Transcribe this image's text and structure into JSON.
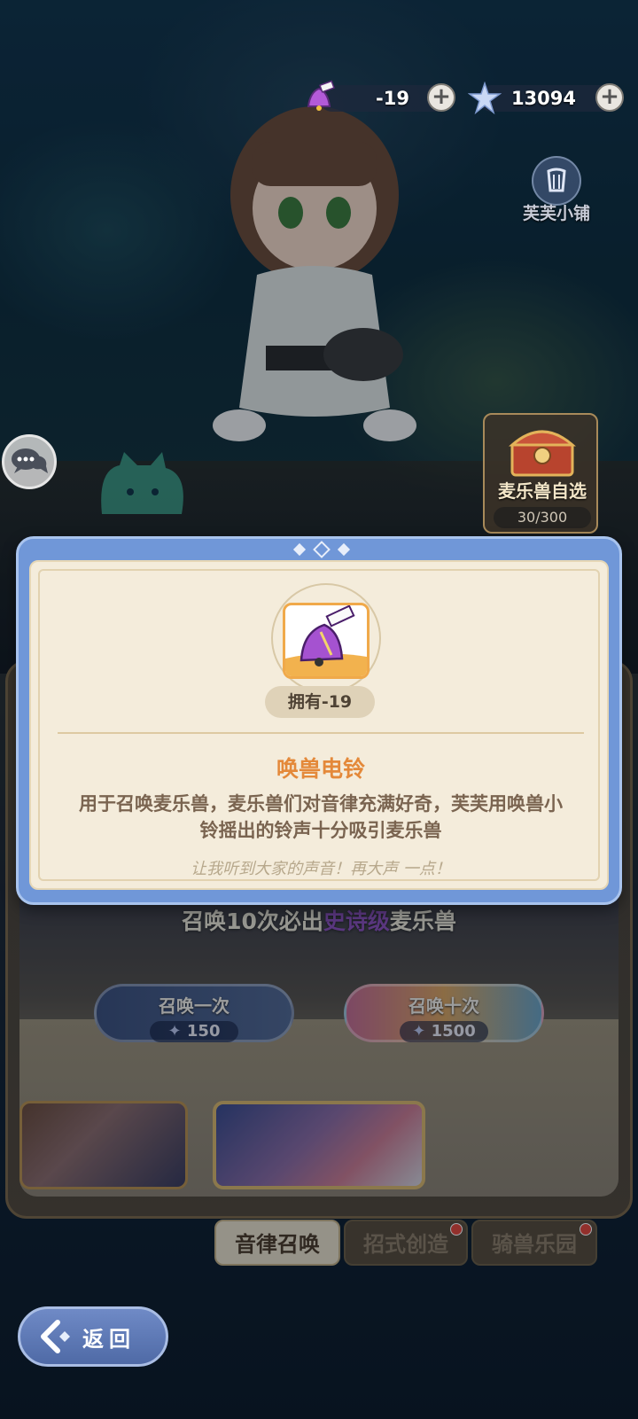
{
  "currencies": {
    "bell": {
      "value": "-19",
      "icon": "bell-icon"
    },
    "star": {
      "value": "13094",
      "icon": "star-icon"
    },
    "plus_label": "+"
  },
  "shop": {
    "label": "芙芙小铺"
  },
  "chest": {
    "label": "麦乐兽自选",
    "count": "30/300"
  },
  "dialog": {
    "owned_label": "拥有-19",
    "item_name": "唤兽电铃",
    "description": "用于召唤麦乐兽，麦乐兽们对音律充满好奇，芙芙用唤兽小铃摇出的铃声十分吸引麦乐兽",
    "quote": "让我听到大家的声音！再大声 一点！"
  },
  "summon": {
    "guarantee_prefix": "召唤10次必出",
    "guarantee_highlight": "史诗级",
    "guarantee_suffix": "麦乐兽",
    "once_label": "召唤一次",
    "once_cost": "150",
    "ten_label": "召唤十次",
    "ten_cost": "1500"
  },
  "tabs": [
    {
      "label": "音律召唤",
      "active": true
    },
    {
      "label": "招式创造",
      "active": false
    },
    {
      "label": "骑兽乐园",
      "active": false
    }
  ],
  "back": {
    "label": "返回"
  },
  "colors": {
    "dialog_frame": "#7097d8",
    "card_bg": "#f4ecdb",
    "item_name": "#e4893a",
    "highlight_purple": "#8a50b8"
  }
}
